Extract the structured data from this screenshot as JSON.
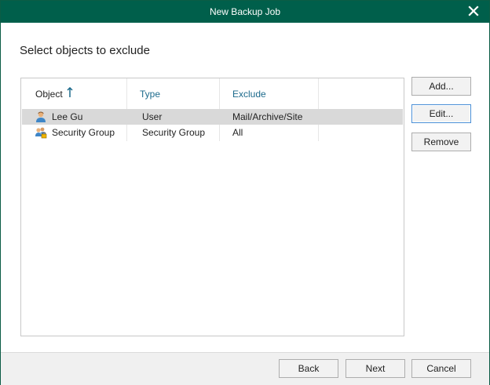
{
  "window": {
    "title": "New Backup Job"
  },
  "heading": "Select objects to exclude",
  "table": {
    "columns": [
      {
        "label": "Object",
        "sort": "ascending"
      },
      {
        "label": "Type"
      },
      {
        "label": "Exclude"
      }
    ],
    "rows": [
      {
        "icon": "user-icon",
        "object": "Lee Gu",
        "type": "User",
        "exclude": "Mail/Archive/Site",
        "selected": true
      },
      {
        "icon": "security-group-icon",
        "object": "Security Group",
        "type": "Security Group",
        "exclude": "All",
        "selected": false
      }
    ]
  },
  "side_buttons": {
    "add": "Add...",
    "edit": "Edit...",
    "remove": "Remove"
  },
  "footer_buttons": {
    "back": "Back",
    "next": "Next",
    "cancel": "Cancel"
  },
  "colors": {
    "titlebar": "#005f4b",
    "header_accent": "#1c6a8c",
    "selected_row": "#d9d9d9"
  }
}
